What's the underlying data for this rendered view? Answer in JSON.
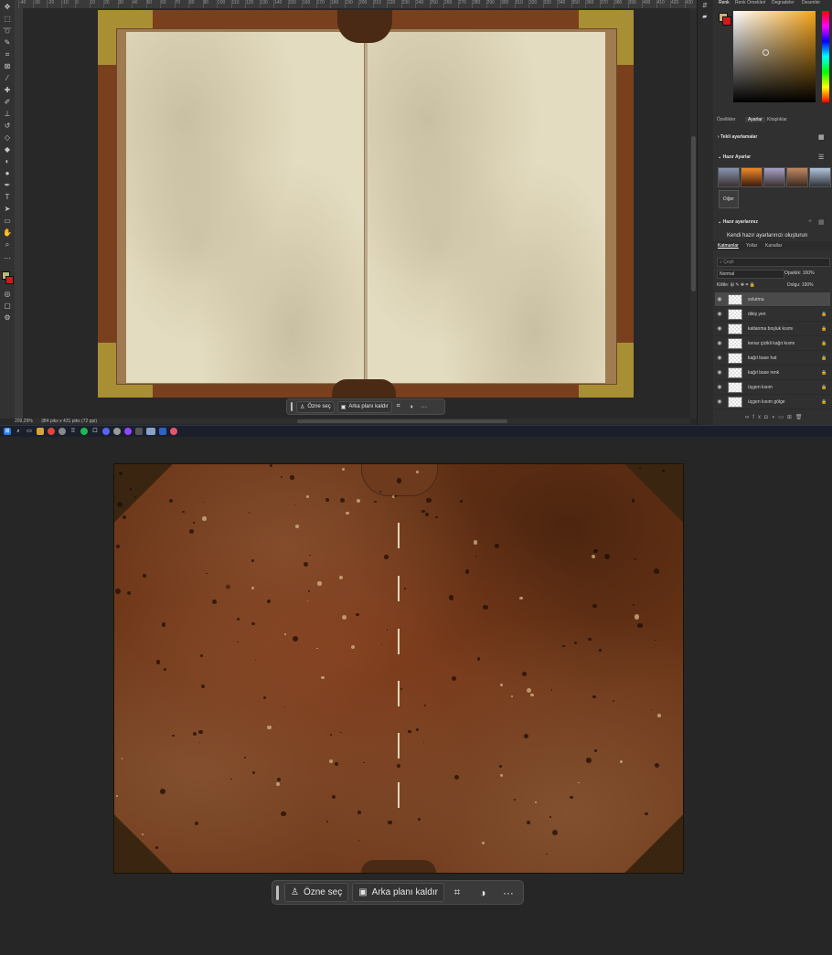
{
  "toolbar": {
    "status_zoom": "209,29%",
    "status_doc": "384 piks x 431 piks (72 ppi)"
  },
  "ruler": {
    "ticks": [
      "-40",
      "-30",
      "-20",
      "-10",
      "0",
      "10",
      "20",
      "30",
      "40",
      "50",
      "60",
      "70",
      "80",
      "90",
      "100",
      "110",
      "120",
      "130",
      "140",
      "150",
      "160",
      "170",
      "180",
      "190",
      "200",
      "210",
      "220",
      "230",
      "240",
      "250",
      "260",
      "270",
      "280",
      "290",
      "300",
      "310",
      "320",
      "330",
      "340",
      "350",
      "360",
      "370",
      "380",
      "390",
      "400",
      "410",
      "420",
      "430",
      "440"
    ]
  },
  "contextual_bar": {
    "select_subject_label": "Özne seç",
    "remove_bg_label": "Arka planı kaldır",
    "more_label": "···"
  },
  "right_panel": {
    "color_tabs": [
      "Renk",
      "Renk Örnekleri",
      "Degradeler",
      "Desenler"
    ],
    "mid_tabs": [
      "Özellikler",
      "Ayarlar",
      "Kitaplıklar"
    ],
    "single_adjustments": "Tekli ayarlamalar",
    "presets_title": "Hazır Ayarlar",
    "more_button": "Diğer",
    "your_presets": "Hazır ayarlarınız",
    "create_presets": "Kendi hazır ayarlarınızı oluşturun",
    "layer_tabs": [
      "Katmanlar",
      "Yollar",
      "Kanallar"
    ],
    "search_placeholder": "Çeşit",
    "blend_mode": "Normal",
    "opacity_label": "Opaklık:",
    "opacity_value": "100%",
    "lock_label": "Kilitle:",
    "fill_label": "Dolgu:",
    "fill_value": "100%",
    "layers": [
      {
        "name": "solutma",
        "locked": false
      },
      {
        "name": "dikiş yeri",
        "locked": true
      },
      {
        "name": "katlanma boşluk kısmı",
        "locked": true
      },
      {
        "name": "kenar çizikli kağıt kısmı",
        "locked": true
      },
      {
        "name": "kağıt base hat",
        "locked": true
      },
      {
        "name": "kağıt base renk",
        "locked": true
      },
      {
        "name": "üçgen kısım",
        "locked": true
      },
      {
        "name": "üçgen kısım gölge",
        "locked": true
      }
    ]
  },
  "colors": {
    "app_bg": "#262626",
    "book_leather": "#7a3f1d",
    "book_gold": "#a98f34",
    "page": "#e4dcc0",
    "board_brown": "#6b3517"
  }
}
